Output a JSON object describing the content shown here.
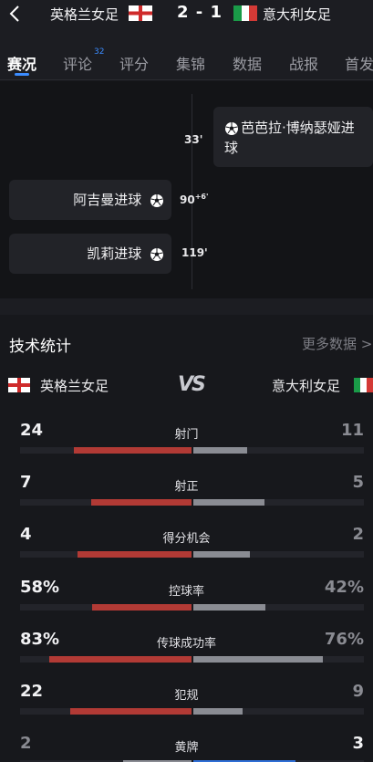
{
  "header": {
    "home_team": "英格兰女足",
    "away_team": "意大利女足",
    "score": "2 - 1"
  },
  "tabs": [
    {
      "label": "赛况",
      "active": true
    },
    {
      "label": "评论",
      "badge": "32"
    },
    {
      "label": "评分"
    },
    {
      "label": "集锦"
    },
    {
      "label": "数据"
    },
    {
      "label": "战报"
    },
    {
      "label": "首发"
    }
  ],
  "timeline": {
    "events": [
      {
        "side": "away",
        "minute": "33'",
        "text": "芭芭拉·博纳瑟娅进球"
      },
      {
        "side": "home",
        "minute": "90",
        "minute_extra": "+6'",
        "text": "阿吉曼进球"
      },
      {
        "side": "home",
        "minute": "119'",
        "text": "凯莉进球"
      }
    ]
  },
  "stats": {
    "title": "技术统计",
    "more_label": "更多数据 >",
    "home_team": "英格兰女足",
    "away_team": "意大利女足",
    "vs": "VS",
    "rows": [
      {
        "label": "射门",
        "home": "24",
        "away": "11",
        "home_frac": 0.686,
        "away_frac": 0.314
      },
      {
        "label": "射正",
        "home": "7",
        "away": "5",
        "home_frac": 0.583,
        "away_frac": 0.417
      },
      {
        "label": "得分机会",
        "home": "4",
        "away": "2",
        "home_frac": 0.667,
        "away_frac": 0.333
      },
      {
        "label": "控球率",
        "home": "58%",
        "away": "42%",
        "home_frac": 0.58,
        "away_frac": 0.42
      },
      {
        "label": "传球成功率",
        "home": "83%",
        "away": "76%",
        "home_frac": 0.83,
        "away_frac": 0.76
      },
      {
        "label": "犯规",
        "home": "22",
        "away": "9",
        "home_frac": 0.71,
        "away_frac": 0.29
      },
      {
        "label": "黄牌",
        "home": "2",
        "away": "3",
        "home_frac": 0.4,
        "away_frac": 0.6
      }
    ]
  },
  "colors": {
    "accent": "#3b8cff",
    "home_bar": "#b23a35",
    "away_bar": "#8a8c93",
    "away_bar_lead": "#2f6fd6"
  }
}
